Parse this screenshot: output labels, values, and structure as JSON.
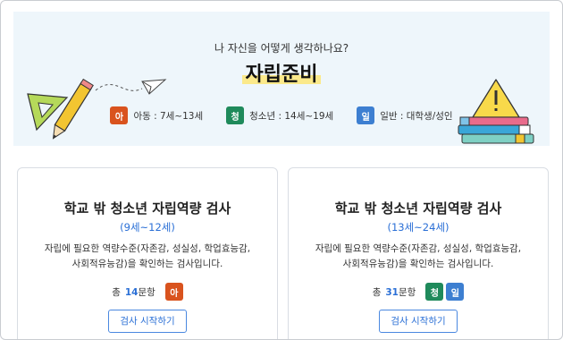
{
  "hero": {
    "subtitle": "나 자신을 어떻게 생각하나요?",
    "title": "자립준비",
    "legend": [
      {
        "badge": "아",
        "color": "#d9531e",
        "label": "아동 : 7세~13세"
      },
      {
        "badge": "청",
        "color": "#1f8a5b",
        "label": "청소년 : 14세~19세"
      },
      {
        "badge": "일",
        "color": "#3d7fd1",
        "label": "일반 : 대학생/성인"
      }
    ]
  },
  "cards": [
    {
      "title": "학교 밖 청소년 자립역량 검사",
      "range": "(9세~12세)",
      "desc1": "자립에 필요한 역량수준(자존감, 성실성, 학업효능감,",
      "desc2": "사회적유능감)을 확인하는 검사입니다.",
      "count_prefix": "총",
      "count_num": "14",
      "count_suffix": "문항",
      "badges": [
        {
          "text": "아",
          "color": "#d9531e"
        }
      ],
      "button": "검사 시작하기"
    },
    {
      "title": "학교 밖 청소년 자립역량 검사",
      "range": "(13세~24세)",
      "desc1": "자립에 필요한 역량수준(자존감, 성실성, 학업효능감,",
      "desc2": "사회적유능감)을 확인하는 검사입니다.",
      "count_prefix": "총",
      "count_num": "31",
      "count_suffix": "문항",
      "badges": [
        {
          "text": "청",
          "color": "#1f8a5b"
        },
        {
          "text": "일",
          "color": "#3d7fd1"
        }
      ],
      "button": "검사 시작하기"
    }
  ],
  "icons": {
    "left_decoration": "ruler-pencil-paper-plane-icon",
    "right_decoration": "warning-books-icon"
  }
}
